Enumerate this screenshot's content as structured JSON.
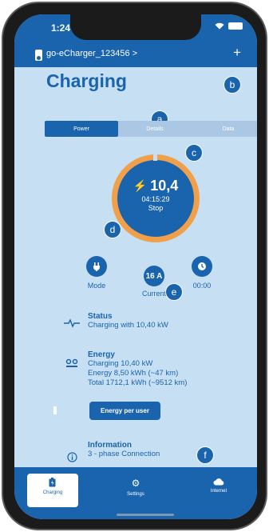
{
  "status_bar": {
    "time": "1:24",
    "wifi_icon": "wifi-icon",
    "battery_icon": "battery-icon"
  },
  "header": {
    "device_name": "go-eCharger_123456 >",
    "add_label": "+"
  },
  "page_title": "Charging",
  "tabs": [
    {
      "label": "Power",
      "active": true
    },
    {
      "label": "Details",
      "active": false
    },
    {
      "label": "Data",
      "active": false
    }
  ],
  "gauge": {
    "power": "10,4",
    "duration": "04:15:29",
    "action": "Stop",
    "ring_color": "#f0a04a"
  },
  "controls": {
    "mode_label": "Mode",
    "current_value": "16 A",
    "current_label": "Current",
    "timer_label": "00:00"
  },
  "markers": {
    "a": "a",
    "b": "b",
    "c": "c",
    "d": "d",
    "e": "e",
    "f": "f"
  },
  "status": {
    "title": "Status",
    "text": "Charging with 10,40 kW"
  },
  "energy": {
    "title": "Energy",
    "lines": [
      "Charging 10,40 kW",
      "Energy 8,50 kWh (~47 km)",
      "Total 1712,1 kWh (~9512 km)"
    ],
    "button": "Energy per user"
  },
  "information": {
    "title": "Information",
    "text": "3 - phase Connection"
  },
  "nav": [
    {
      "label": "Charging",
      "icon": "charging-icon"
    },
    {
      "label": "Settings",
      "icon": "gear-icon"
    },
    {
      "label": "Internet",
      "icon": "cloud-icon"
    }
  ],
  "colors": {
    "primary": "#1a64ae",
    "background": "#c7dff3",
    "accent": "#f0a04a"
  }
}
